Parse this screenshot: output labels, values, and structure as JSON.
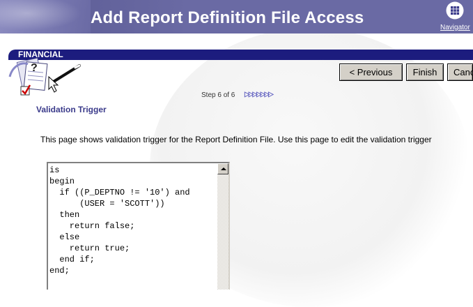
{
  "header": {
    "title": "Add Report Definition File Access",
    "navigator_label": "Navigator",
    "navigator_icon": "grid-icon"
  },
  "section": {
    "label": "FINANCIAL",
    "icon": "wizard-icon"
  },
  "buttons": {
    "previous": "< Previous",
    "finish": "Finish",
    "cancel": "Canc"
  },
  "step": {
    "text": "Step 6 of 6",
    "arrows": "▷▷▷▷▷▷▷"
  },
  "page": {
    "subtitle": "Validation Trigger",
    "description": "This page shows validation trigger for the Report Definition File. Use this page to edit the validation trigger"
  },
  "editor": {
    "code": "is\nbegin\n  if ((P_DEPTNO != '10') and\n      (USER = 'SCOTT'))\n  then\n    return false;\n  else\n    return true;\n  end if;\nend;"
  },
  "colors": {
    "header": "#6a6aa4",
    "section_bar": "#1c1c7e",
    "subtitle": "#3a3a8a"
  }
}
